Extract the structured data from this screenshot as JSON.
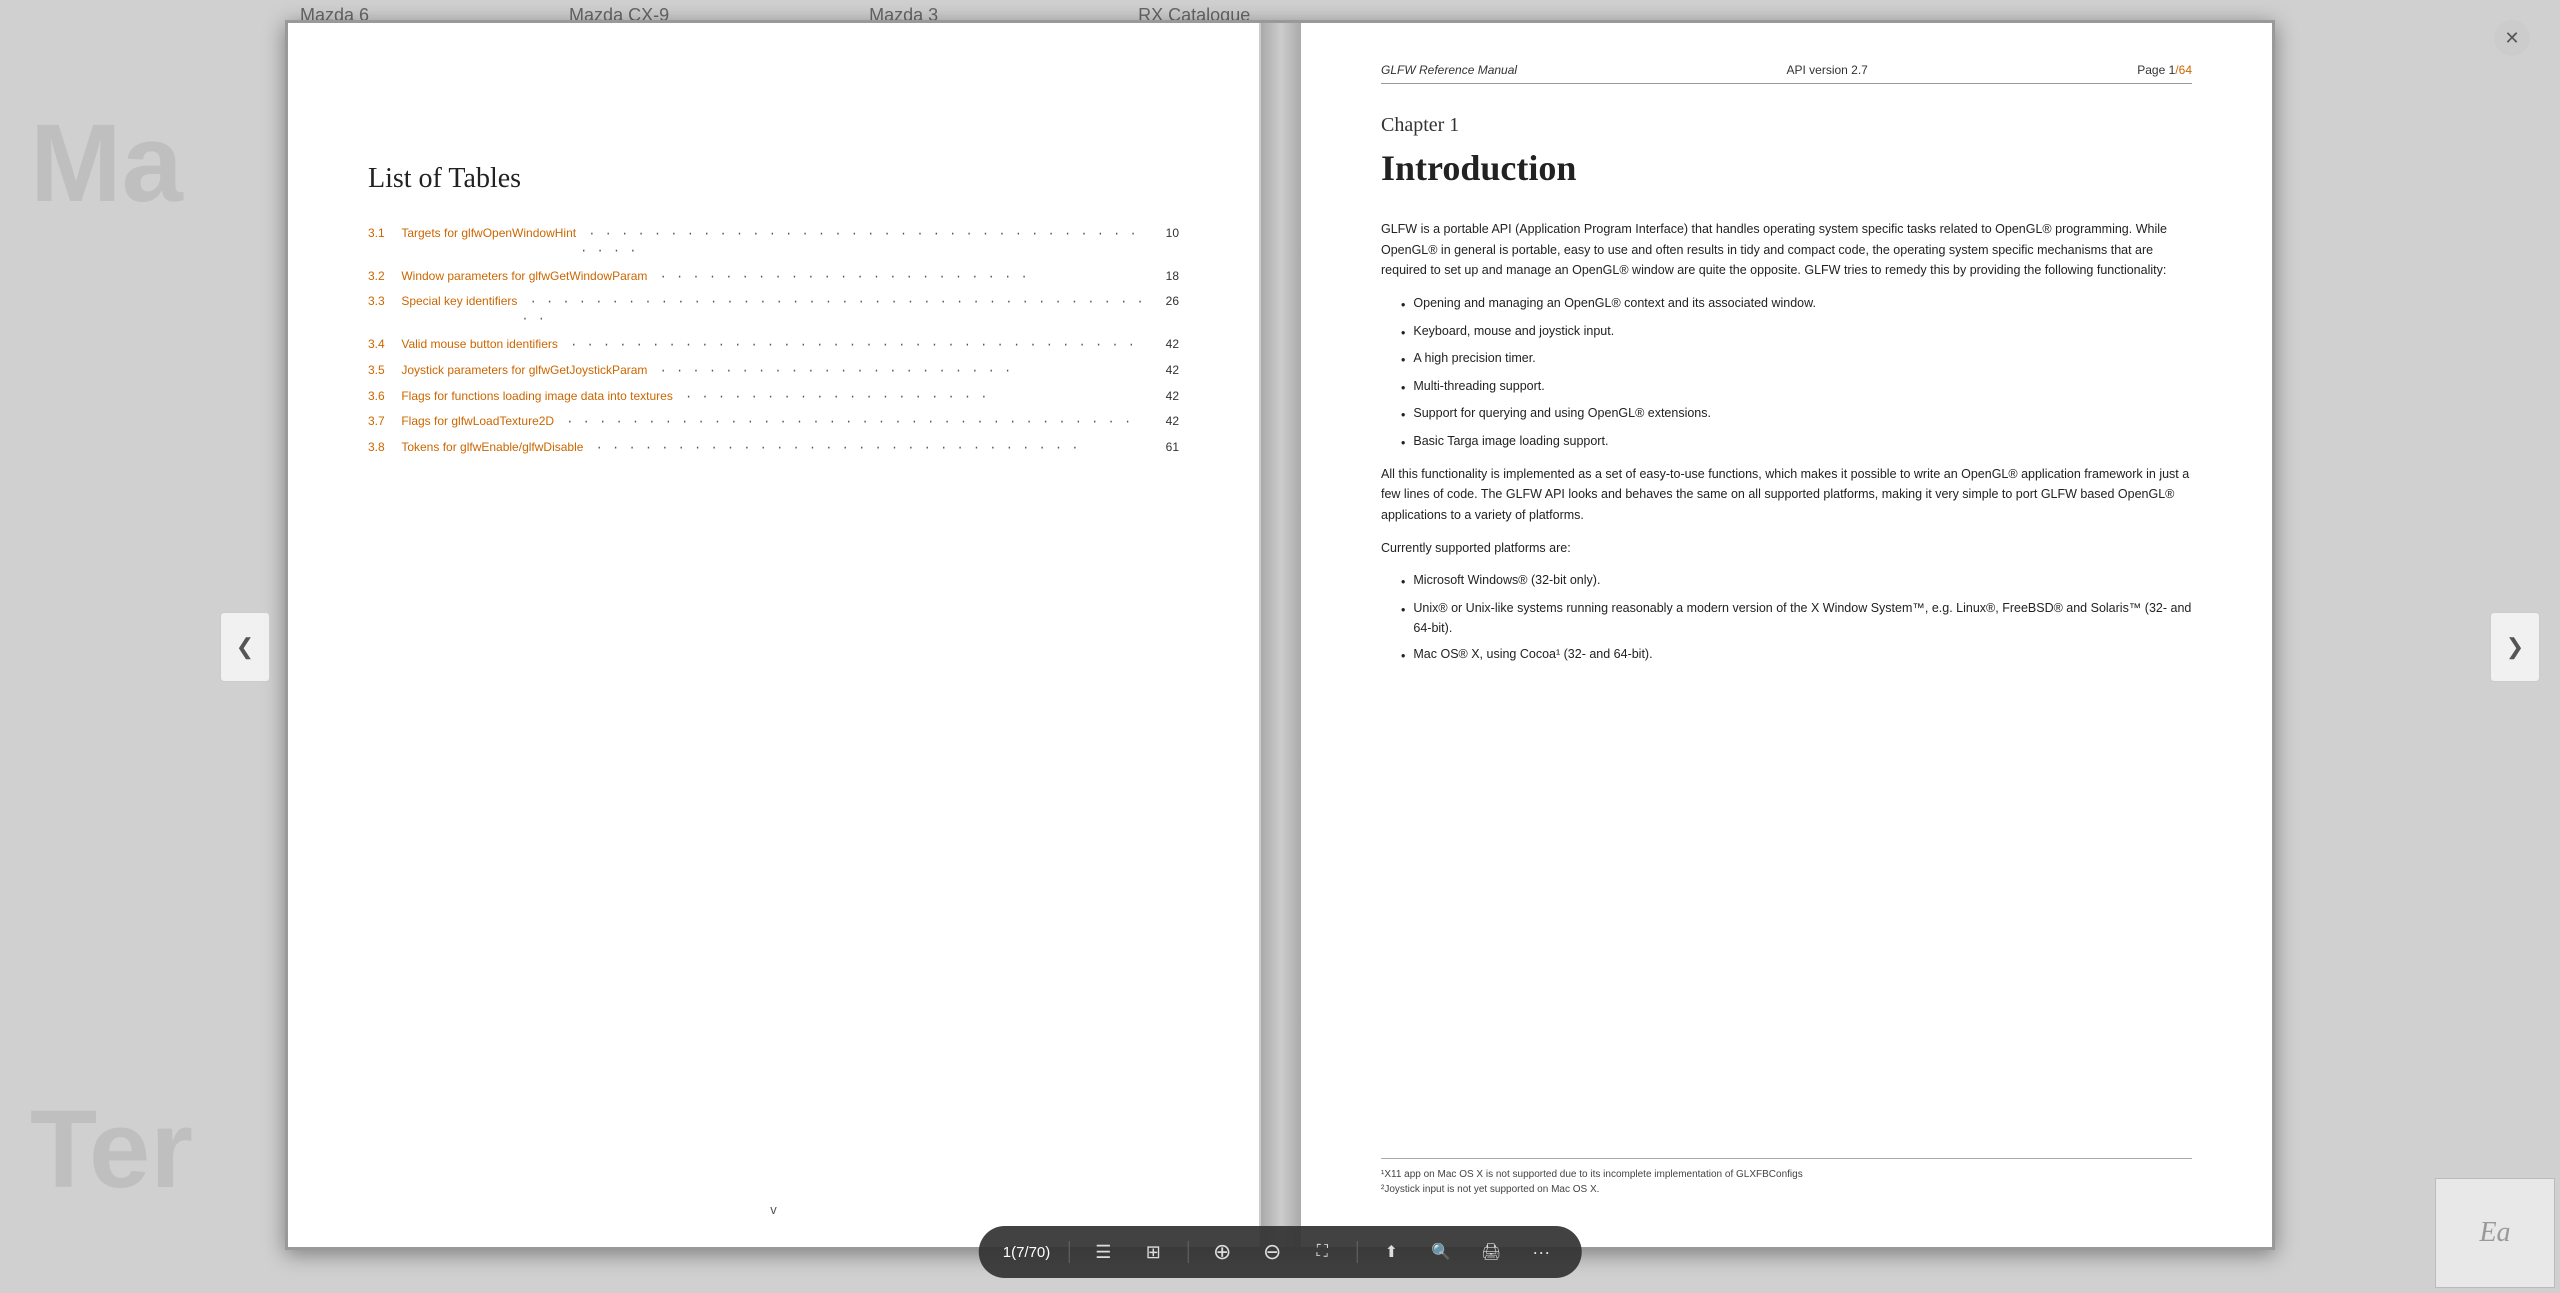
{
  "browser_tabs": [
    {
      "label": "Mazda 6"
    },
    {
      "label": "Mazda CX-9"
    },
    {
      "label": "Mazda 3"
    },
    {
      "label": "RX Catalogue"
    }
  ],
  "close_button_label": "✕",
  "background_text_left": "Ma",
  "background_text_bottom": "Ter",
  "nav_arrow_left": "❮",
  "nav_arrow_right": "❯",
  "left_page": {
    "title": "List of Tables",
    "toc_entries": [
      {
        "num": "3.1",
        "text": "Targets for glfwOpenWindowHint",
        "dots": "· · · · · · · · · · · · · · · · · · · · · · · · · · · · · · · · · · · · · ·",
        "page": "10"
      },
      {
        "num": "3.2",
        "text": "Window parameters for glfwGetWindowParam",
        "dots": "· · · · · · · · · · · · · · · · · · · · · · ·",
        "page": "18"
      },
      {
        "num": "3.3",
        "text": "Special key identifiers",
        "dots": "· · · · · · · · · · · · · · · · · · · · · · · · · · · · · · · · · · · · · · · ·",
        "page": "26"
      },
      {
        "num": "3.4",
        "text": "Valid mouse button identifiers",
        "dots": "· · · · · · · · · · · · · · · · · · · · · · · · · · · · · · · · · · ·",
        "page": "42"
      },
      {
        "num": "3.5",
        "text": "Joystick parameters for glfwGetJoystickParam",
        "dots": "· · · · · · · · · · · · · · · · · · · · · ·",
        "page": "42"
      },
      {
        "num": "3.6",
        "text": "Flags for functions loading image data into textures",
        "dots": "· · · · · · · · · · · · · · · · · · ·",
        "page": "42"
      },
      {
        "num": "3.7",
        "text": "Flags for glfwLoadTexture2D",
        "dots": "· · · · · · · · · · · · · · · · · · · · · · · · · · · · · · · · · · ·",
        "page": "42"
      },
      {
        "num": "3.8",
        "text": "Tokens for glfwEnable/glfwDisable",
        "dots": "· · · · · · · · · · · · · · · · · · · · · · · · · · · · · ·",
        "page": "61"
      }
    ],
    "page_number": "v"
  },
  "right_page": {
    "header": {
      "title": "GLFW Reference Manual",
      "version": "API version 2.7",
      "page_label": "Page 1",
      "page_slash": "/",
      "page_total": "64"
    },
    "chapter_label": "Chapter 1",
    "chapter_title": "Introduction",
    "paragraphs": [
      "GLFW is a portable API (Application Program Interface) that handles operating system specific tasks related to OpenGL® programming. While OpenGL® in general is portable, easy to use and often results in tidy and compact code, the operating system specific mechanisms that are required to set up and manage an OpenGL® window are quite the opposite. GLFW tries to remedy this by providing the following functionality:"
    ],
    "bullets_1": [
      "Opening and managing an OpenGL® context and its associated window.",
      "Keyboard, mouse and joystick input.",
      "A high precision timer.",
      "Multi-threading support.",
      "Support for querying and using OpenGL® extensions.",
      "Basic Targa image loading support."
    ],
    "paragraph_2": "All this functionality is implemented as a set of easy-to-use functions, which makes it possible to write an OpenGL® application framework in just a few lines of code. The GLFW API looks and behaves the same on all supported platforms, making it very simple to port GLFW based OpenGL® applications to a variety of platforms.",
    "paragraph_3": "Currently supported platforms are:",
    "bullets_2": [
      "Microsoft Windows® (32-bit only).",
      "Unix® or Unix-like systems running reasonably a modern version of the X Window System™, e.g. Linux®, FreeBSD® and Solaris™ (32- and 64-bit).",
      "Mac OS® X, using Cocoa¹ (32- and 64-bit)."
    ],
    "footnotes": [
      "¹X11 app on Mac OS X is not supported due to its incomplete implementation of GLXFBConfigs",
      "²Joystick input is not yet supported on Mac OS X."
    ]
  },
  "toolbar": {
    "page_info": "1(7/70)",
    "icons": [
      {
        "name": "outline",
        "symbol": "☰"
      },
      {
        "name": "grid",
        "symbol": "⊞"
      },
      {
        "name": "zoom-in",
        "symbol": "+"
      },
      {
        "name": "zoom-out",
        "symbol": "−"
      },
      {
        "name": "fullscreen",
        "symbol": "⛶"
      },
      {
        "name": "share",
        "symbol": "⬆"
      },
      {
        "name": "search",
        "symbol": "🔍"
      },
      {
        "name": "print",
        "symbol": "🖨"
      },
      {
        "name": "more",
        "symbol": "···"
      }
    ]
  },
  "bottom_right": {
    "text": "Ea"
  }
}
